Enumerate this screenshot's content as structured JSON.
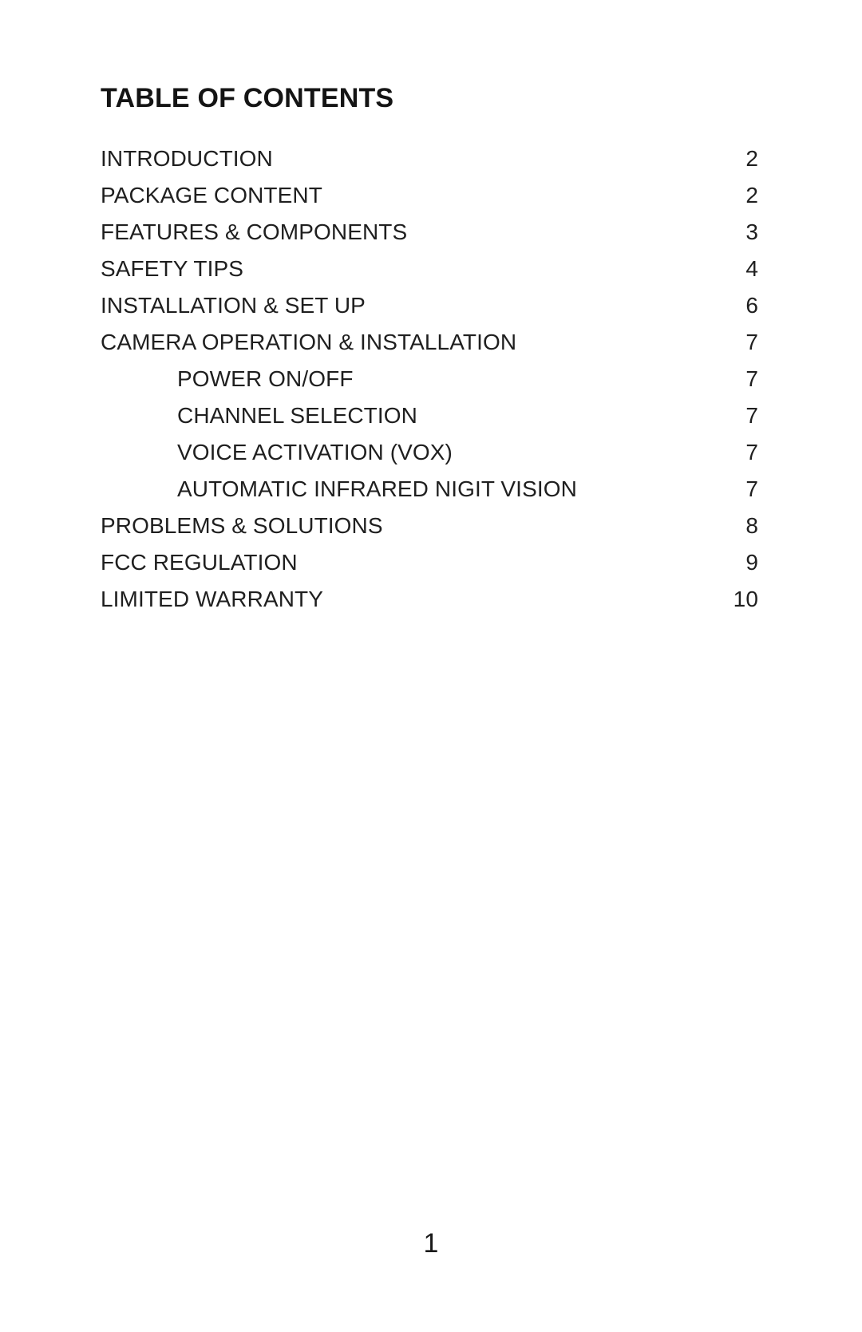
{
  "document": {
    "title": "TABLE OF CONTENTS",
    "footer_page_number": "1",
    "text_color": "#1a1a1a",
    "background_color": "#ffffff"
  },
  "toc": {
    "entries": [
      {
        "label": "INTRODUCTION",
        "page": "2",
        "level": 0
      },
      {
        "label": "PACKAGE CONTENT",
        "page": "2",
        "level": 0
      },
      {
        "label": "FEATURES & COMPONENTS",
        "page": "3",
        "level": 0
      },
      {
        "label": "SAFETY TIPS",
        "page": "4",
        "level": 0
      },
      {
        "label": "INSTALLATION & SET UP",
        "page": "6",
        "level": 0
      },
      {
        "label": "CAMERA OPERATION & INSTALLATION",
        "page": "7",
        "level": 0
      },
      {
        "label": "POWER ON/OFF",
        "page": "7",
        "level": 1
      },
      {
        "label": "CHANNEL SELECTION",
        "page": "7",
        "level": 1
      },
      {
        "label": "VOICE ACTIVATION (VOX)",
        "page": "7",
        "level": 1
      },
      {
        "label": "AUTOMATIC INFRARED NIGIT VISION",
        "page": "7",
        "level": 1
      },
      {
        "label": "PROBLEMS & SOLUTIONS",
        "page": "8",
        "level": 0
      },
      {
        "label": "FCC REGULATION",
        "page": "9",
        "level": 0
      },
      {
        "label": "LIMITED WARRANTY",
        "page": "10",
        "level": 0
      }
    ]
  }
}
